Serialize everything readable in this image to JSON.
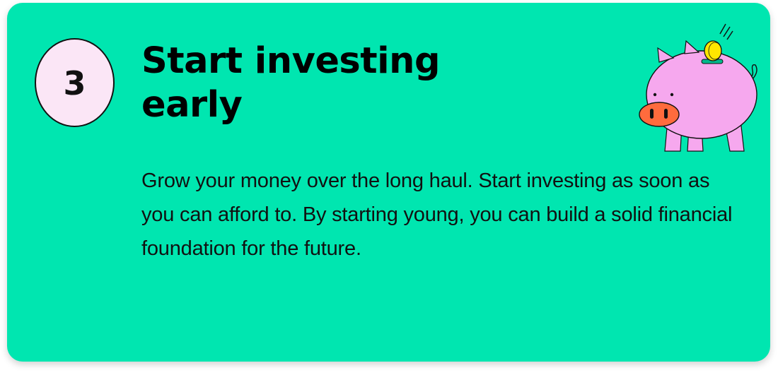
{
  "card": {
    "step_number": "3",
    "title": "Start investing early",
    "body": "Grow your money over the long haul. Start investing as soon as you can afford to. By starting young, you can build a solid financial foundation for the future."
  },
  "illustration": {
    "icon": "piggy-bank-icon",
    "colors": {
      "body": "#F6A8EE",
      "snout": "#FF6B3D",
      "coin": "#FFE600"
    }
  },
  "colors": {
    "card_background": "#00E6B0",
    "badge_background": "#FBE6F6",
    "text": "#000000"
  }
}
